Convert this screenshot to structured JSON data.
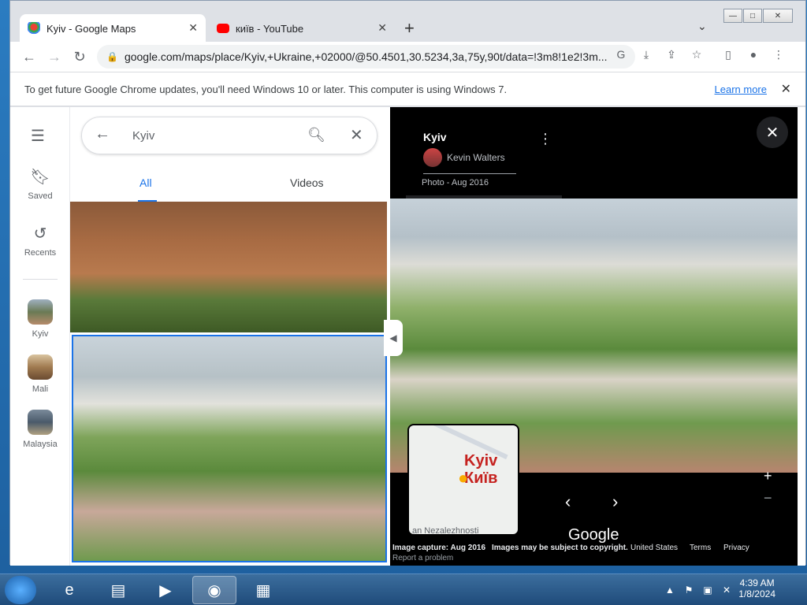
{
  "browser": {
    "tabs": [
      {
        "label": "Kyiv - Google Maps",
        "active": true
      },
      {
        "label": "київ - YouTube",
        "active": false
      }
    ],
    "url": "google.com/maps/place/Kyiv,+Ukraine,+02000/@50.4501,30.5234,3a,75y,90t/data=!3m8!1e2!3m..."
  },
  "infobar": {
    "message": "To get future Google Chrome updates, you'll need Windows 10 or later. This computer is using Windows 7.",
    "learn_more": "Learn more"
  },
  "rail": {
    "saved": "Saved",
    "recents": "Recents",
    "places": [
      "Kyiv",
      "Mali",
      "Malaysia"
    ]
  },
  "search": {
    "query": "Kyiv"
  },
  "photo_tabs": {
    "all": "All",
    "videos": "Videos"
  },
  "viewer": {
    "title": "Kyiv",
    "author": "Kevin Walters",
    "photo_date": "Photo - Aug 2016",
    "minimap_label_en": "Kyiv",
    "minimap_label_uk": "Київ",
    "minimap_street": "an Nezalezhnosti",
    "google": "Google",
    "image_capture": "Image capture: Aug 2016",
    "copyright": "Images may be subject to copyright.",
    "country": "United States",
    "terms": "Terms",
    "privacy": "Privacy",
    "report": "Report a problem"
  },
  "taskbar": {
    "time": "4:39 AM",
    "date": "1/8/2024"
  },
  "colors": {
    "accent": "#1a73e8",
    "viewer_bg": "#000000"
  }
}
